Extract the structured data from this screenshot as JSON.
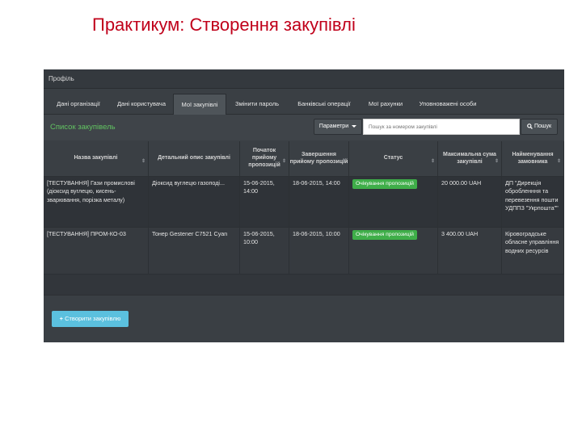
{
  "slide": {
    "title": "Практикум: Створення закупівлі"
  },
  "app": {
    "profile_label": "Профіль",
    "tabs": [
      {
        "label": "Дані організації",
        "active": false
      },
      {
        "label": "Дані користувача",
        "active": false
      },
      {
        "label": "Мої закупівлі",
        "active": true
      },
      {
        "label": "Змінити пароль",
        "active": false
      },
      {
        "label": "Банківські операції",
        "active": false
      },
      {
        "label": "Мої рахунки",
        "active": false
      },
      {
        "label": "Уповноважені особи",
        "active": false
      }
    ],
    "panel": {
      "title": "Список закупівель",
      "params_label": "Параметри",
      "search_placeholder": "Пошук за номером закупівлі",
      "search_button": "Пошук"
    },
    "table": {
      "headers": [
        "Назва закупівлі",
        "Детальний опис закупівлі",
        "Початок прийому пропозицій",
        "Завершення прийому пропозицій",
        "Статус",
        "Максимальна сума закупівлі",
        "Найменування замовника"
      ],
      "rows": [
        {
          "name": "[ТЕСТУВАННЯ] Гази промислові (діоксид вуглецю, кисень-зварювання, порізка металу)",
          "description": "Діоксид вуглецю газоподі...",
          "start": "15-06-2015, 14:00",
          "end": "18-06-2015, 14:00",
          "status": "Очікування пропозицій",
          "amount": "20 000.00 UAH",
          "customer": "ДП \"Дирекція обробленння та перевезення пошти УДППЗ \"Укрпошта\"\""
        },
        {
          "name": "[ТЕСТУВАННЯ] ПРОМ-КО-03",
          "description": "Тонер Gestener C7521 Cyan",
          "start": "15-06-2015, 10:00",
          "end": "18-06-2015, 10:00",
          "status": "Очікування пропозицій",
          "amount": "3 400.00 UAH",
          "customer": "Кіровоградське обласне управління водних ресурсів"
        }
      ]
    },
    "create_button": "Створити закупівлю",
    "colors": {
      "background": "#3a3f44",
      "accent_green": "#62c462",
      "status_green": "#3fae49",
      "create_button": "#5bc0de",
      "title_red": "#c0001a"
    },
    "icons": [
      "search-icon",
      "plus-icon",
      "caret-down-icon",
      "sort-icon"
    ]
  }
}
